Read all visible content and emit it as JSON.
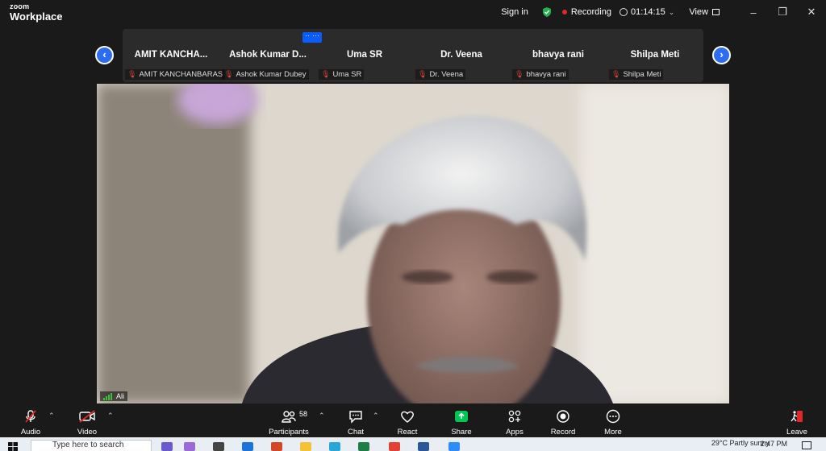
{
  "app": {
    "brand_small": "zoom",
    "brand_large": "Workplace"
  },
  "titlebar": {
    "signin": "Sign in",
    "recording": "Recording",
    "timer": "01:14:15",
    "view": "View"
  },
  "participants": [
    {
      "tile_name": "AMIT  KANCHA...",
      "label": "AMIT KANCHANBARAS",
      "has_menu": false
    },
    {
      "tile_name": "Ashok Kumar D...",
      "label": "Ashok Kumar Dubey",
      "has_menu": true
    },
    {
      "tile_name": "Uma SR",
      "label": "Uma SR",
      "has_menu": true
    },
    {
      "tile_name": "Dr. Veena",
      "label": "Dr. Veena",
      "has_menu": false
    },
    {
      "tile_name": "bhavya rani",
      "label": "bhavya rani",
      "has_menu": false
    },
    {
      "tile_name": "Shilpa Meti",
      "label": "Shilpa Meti",
      "has_menu": false
    }
  ],
  "more_glyph": "···",
  "video": {
    "speaker": "Ali"
  },
  "toolbar": {
    "audio": "Audio",
    "video": "Video",
    "participants": "Participants",
    "participants_count": "58",
    "chat": "Chat",
    "react": "React",
    "share": "Share",
    "apps": "Apps",
    "record": "Record",
    "more": "More",
    "leave": "Leave"
  },
  "taskbar": {
    "search_placeholder": "Type here to search",
    "weather": "29°C  Partly sunny",
    "time": "2:47 PM"
  },
  "colors": {
    "accent": "#0b5cff",
    "share": "#00c853",
    "leave": "#e02828",
    "recording": "#e02828"
  }
}
